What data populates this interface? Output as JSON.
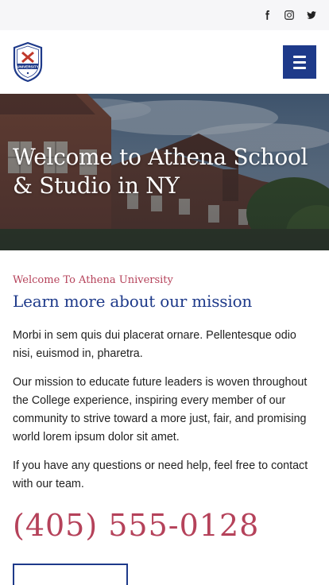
{
  "topbar": {
    "social_icons": [
      "facebook-icon",
      "instagram-icon",
      "twitter-icon"
    ]
  },
  "header": {
    "logo_text": "UNIVERSITY",
    "menu_icon": "hamburger-menu-icon"
  },
  "hero": {
    "title": "Welcome to Athena School & Studio in NY"
  },
  "main": {
    "eyebrow": "Welcome To Athena University",
    "heading": "Learn more about our mission",
    "paragraphs": [
      "Morbi in sem quis dui placerat ornare. Pellentesque odio nisi, euismod in, pharetra.",
      "Our mission to educate future leaders is woven throughout the College experience, inspiring every member of our community to strive toward a more just, fair, and promising world lorem ipsum dolor sit amet.",
      "If you have any questions or need help, feel free to contact with our team."
    ],
    "phone": "(405) 555-0128"
  },
  "colors": {
    "accent": "#b5425a",
    "brand": "#1e3a8a",
    "topbar_bg": "#f6f6f8"
  }
}
